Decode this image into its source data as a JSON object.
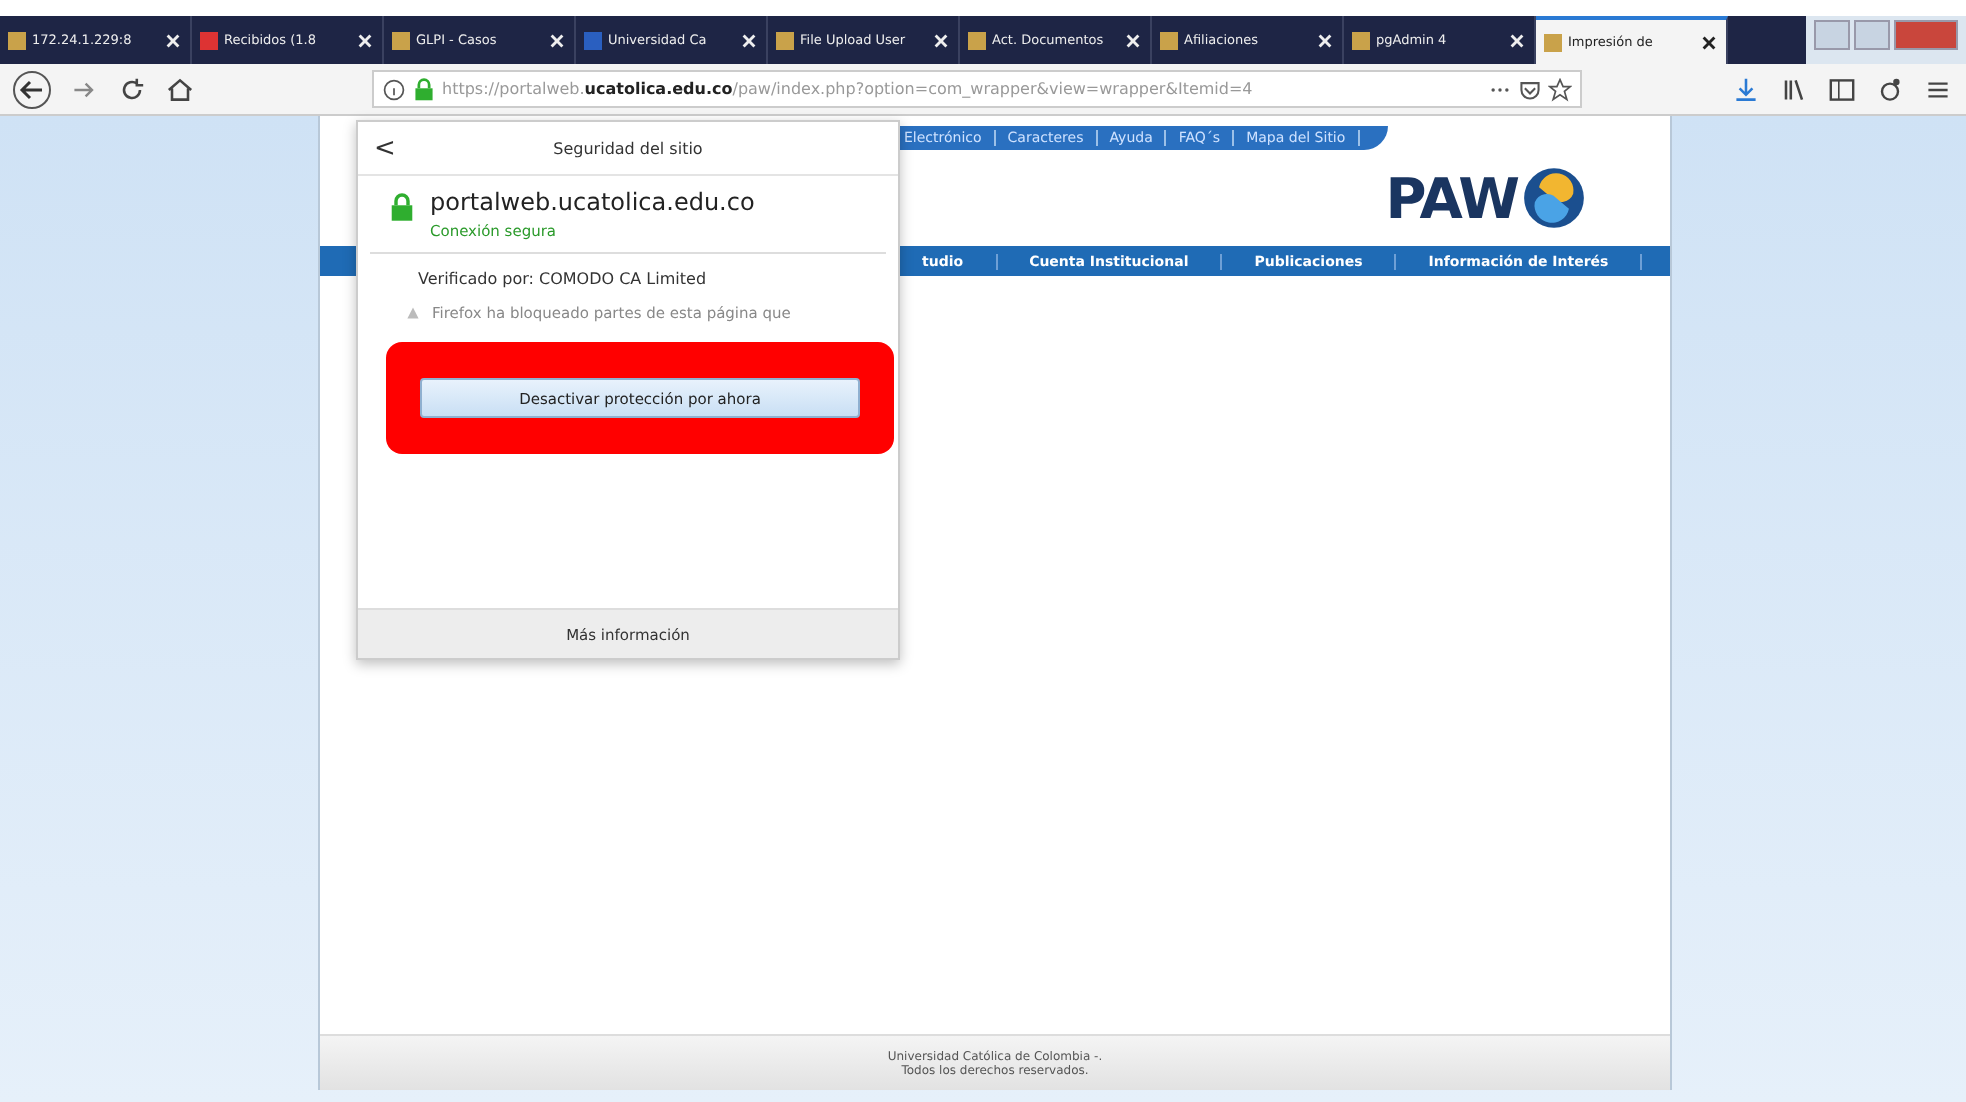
{
  "tabs": [
    {
      "label": "172.24.1.229:8",
      "selected": false
    },
    {
      "label": "Recibidos (1.8",
      "selected": false
    },
    {
      "label": "GLPI - Casos",
      "selected": false
    },
    {
      "label": "Universidad Ca",
      "selected": false
    },
    {
      "label": "File Upload User",
      "selected": false
    },
    {
      "label": "Act. Documentos",
      "selected": false
    },
    {
      "label": "Afiliaciones",
      "selected": false
    },
    {
      "label": "pgAdmin 4",
      "selected": false
    },
    {
      "label": "Impresión de",
      "selected": true
    }
  ],
  "address_bar": {
    "url": "https://portalweb.**ucatolica.edu.co**/paw/index.php?option=com_wrapper&view=wrapper&Itemid=4"
  },
  "site": {
    "top_links": [
      "Electrónico",
      "Caracteres",
      "Ayuda",
      "FAQ´s",
      "Mapa del Sitio"
    ],
    "logo": "PAW",
    "main_nav": [
      "tudio",
      "Cuenta Institucional",
      "Publicaciones",
      "Información de Interés"
    ],
    "footer": [
      "Universidad Católica de Colombia -.",
      "Todos los derechos reservados."
    ]
  },
  "popup": {
    "back": "<",
    "title": "Seguridad del sitio",
    "domain": "portalweb.ucatolica.edu.co",
    "connection": "Conexión segura",
    "verified": "Verificado por: COMODO CA Limited",
    "warning": "Firefox ha bloqueado partes de esta página que",
    "button": "Desactivar protección por ahora",
    "more": "Más información"
  }
}
